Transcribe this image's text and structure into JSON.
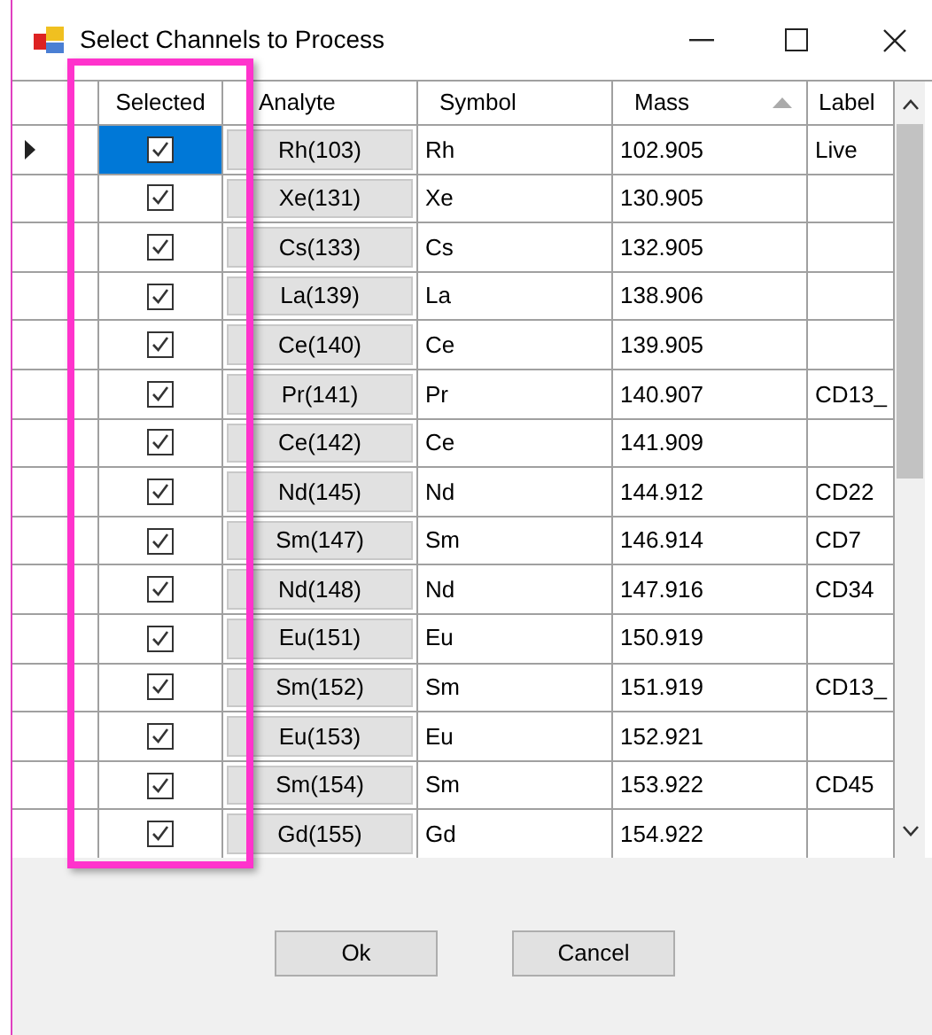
{
  "window": {
    "title": "Select Channels to Process"
  },
  "table": {
    "columns": [
      {
        "label": "Selected",
        "sorted": false
      },
      {
        "label": "Analyte",
        "sorted": false
      },
      {
        "label": "Symbol",
        "sorted": false
      },
      {
        "label": "Mass",
        "sorted": true
      },
      {
        "label": "Label",
        "sorted": false
      }
    ],
    "rows": [
      {
        "current": true,
        "checked": true,
        "analyte": "Rh(103)",
        "symbol": "Rh",
        "mass": "102.905",
        "label": "Live"
      },
      {
        "current": false,
        "checked": true,
        "analyte": "Xe(131)",
        "symbol": "Xe",
        "mass": "130.905"
      },
      {
        "current": false,
        "checked": true,
        "analyte": "Cs(133)",
        "symbol": "Cs",
        "mass": "132.905"
      },
      {
        "current": false,
        "checked": true,
        "analyte": "La(139)",
        "symbol": "La",
        "mass": "138.906"
      },
      {
        "current": false,
        "checked": true,
        "analyte": "Ce(140)",
        "symbol": "Ce",
        "mass": "139.905"
      },
      {
        "current": false,
        "checked": true,
        "analyte": "Pr(141)",
        "symbol": "Pr",
        "mass": "140.907",
        "label": "CD13_"
      },
      {
        "current": false,
        "checked": true,
        "analyte": "Ce(142)",
        "symbol": "Ce",
        "mass": "141.909"
      },
      {
        "current": false,
        "checked": true,
        "analyte": "Nd(145)",
        "symbol": "Nd",
        "mass": "144.912",
        "label": "CD22"
      },
      {
        "current": false,
        "checked": true,
        "analyte": "Sm(147)",
        "symbol": "Sm",
        "mass": "146.914",
        "label": "CD7"
      },
      {
        "current": false,
        "checked": true,
        "analyte": "Nd(148)",
        "symbol": "Nd",
        "mass": "147.916",
        "label": "CD34"
      },
      {
        "current": false,
        "checked": true,
        "analyte": "Eu(151)",
        "symbol": "Eu",
        "mass": "150.919"
      },
      {
        "current": false,
        "checked": true,
        "analyte": "Sm(152)",
        "symbol": "Sm",
        "mass": "151.919",
        "label": "CD13_"
      },
      {
        "current": false,
        "checked": true,
        "analyte": "Eu(153)",
        "symbol": "Eu",
        "mass": "152.921"
      },
      {
        "current": false,
        "checked": true,
        "analyte": "Sm(154)",
        "symbol": "Sm",
        "mass": "153.922",
        "label": "CD45"
      },
      {
        "current": false,
        "checked": true,
        "analyte": "Gd(155)",
        "symbol": "Gd",
        "mass": "154.922"
      }
    ]
  },
  "buttons": [
    "Ok",
    "Cancel"
  ]
}
